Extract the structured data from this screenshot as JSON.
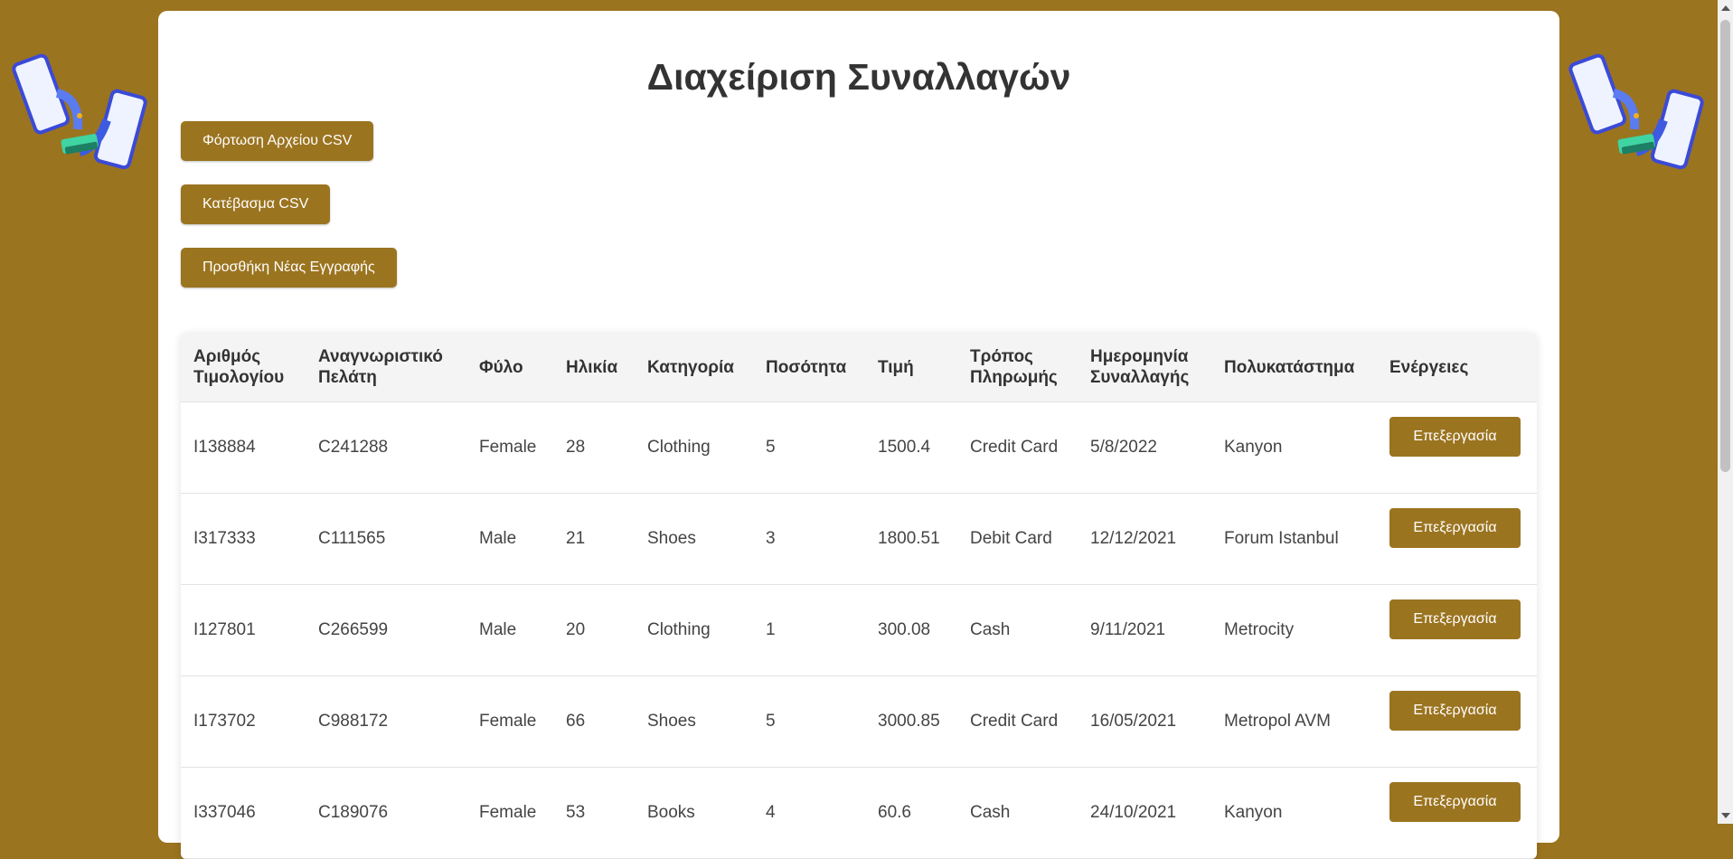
{
  "title": "Διαχείριση Συναλλαγών",
  "buttons": {
    "load_csv": "Φόρτωση Αρχείου CSV",
    "download_csv": "Κατέβασμα CSV",
    "add_record": "Προσθήκη Νέας Εγγραφής"
  },
  "table": {
    "headers": {
      "invoice_no": "Αριθμός Τιμολογίου",
      "customer_id": "Αναγνωριστικό Πελάτη",
      "gender": "Φύλο",
      "age": "Ηλικία",
      "category": "Κατηγορία",
      "quantity": "Ποσότητα",
      "price": "Τιμή",
      "payment_method": "Τρόπος Πληρωμής",
      "date": "Ημερομηνία Συναλλαγής",
      "mall": "Πολυκατάστημα",
      "actions": "Ενέργειες"
    },
    "edit_label": "Επεξεργασία",
    "rows": [
      {
        "invoice_no": "I138884",
        "customer_id": "C241288",
        "gender": "Female",
        "age": "28",
        "category": "Clothing",
        "quantity": "5",
        "price": "1500.4",
        "payment_method": "Credit Card",
        "date": "5/8/2022",
        "mall": "Kanyon"
      },
      {
        "invoice_no": "I317333",
        "customer_id": "C111565",
        "gender": "Male",
        "age": "21",
        "category": "Shoes",
        "quantity": "3",
        "price": "1800.51",
        "payment_method": "Debit Card",
        "date": "12/12/2021",
        "mall": "Forum Istanbul"
      },
      {
        "invoice_no": "I127801",
        "customer_id": "C266599",
        "gender": "Male",
        "age": "20",
        "category": "Clothing",
        "quantity": "1",
        "price": "300.08",
        "payment_method": "Cash",
        "date": "9/11/2021",
        "mall": "Metrocity"
      },
      {
        "invoice_no": "I173702",
        "customer_id": "C988172",
        "gender": "Female",
        "age": "66",
        "category": "Shoes",
        "quantity": "5",
        "price": "3000.85",
        "payment_method": "Credit Card",
        "date": "16/05/2021",
        "mall": "Metropol AVM"
      },
      {
        "invoice_no": "I337046",
        "customer_id": "C189076",
        "gender": "Female",
        "age": "53",
        "category": "Books",
        "quantity": "4",
        "price": "60.6",
        "payment_method": "Cash",
        "date": "24/10/2021",
        "mall": "Kanyon"
      }
    ]
  },
  "colors": {
    "accent": "#9b7420",
    "background": "#9b7420"
  },
  "icons": {
    "decoration": "money-transfer-phones-icon"
  }
}
